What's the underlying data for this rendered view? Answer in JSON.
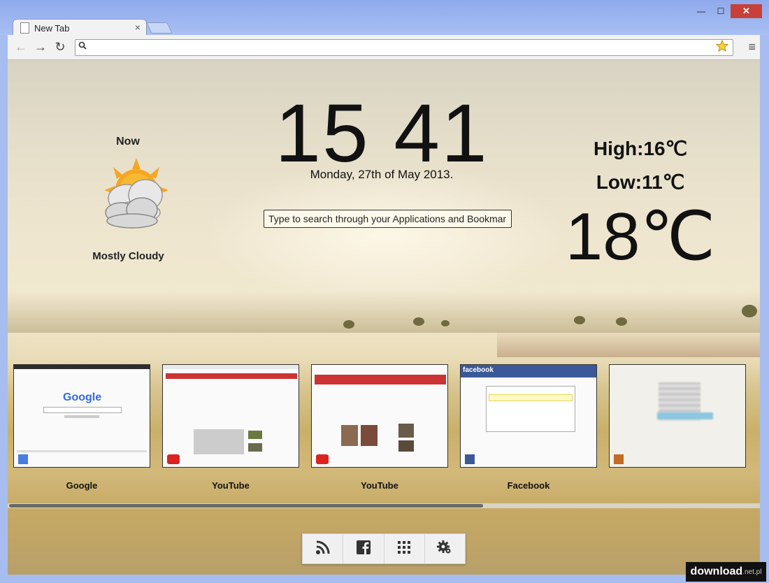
{
  "browser": {
    "tab_title": "New Tab",
    "tab_close": "×",
    "omnibox_value": "",
    "window_buttons": {
      "minimize": "—",
      "maximize": "☐",
      "close": "✕"
    },
    "nav": {
      "back": "←",
      "forward": "→",
      "reload": "↻"
    },
    "menu_icon": "≡",
    "star_icon": "☆"
  },
  "weather": {
    "now_label": "Now",
    "condition": "Mostly Cloudy",
    "high": "High:16℃",
    "low": "Low:11℃",
    "current_temp": "18℃"
  },
  "clock": {
    "time": "15 41",
    "date": "Monday, 27th of May 2013."
  },
  "search": {
    "placeholder": "Type to search through your Applications and Bookmarks"
  },
  "tiles": [
    {
      "label": "Google",
      "logo_text": "Google"
    },
    {
      "label": "YouTube"
    },
    {
      "label": "YouTube"
    },
    {
      "label": "Facebook",
      "logo_text": "facebook"
    },
    {
      "label": ""
    }
  ],
  "scroll_position": 0.63,
  "dock": [
    {
      "name": "rss-icon"
    },
    {
      "name": "facebook-icon"
    },
    {
      "name": "apps-grid-icon"
    },
    {
      "name": "settings-gear-icon"
    }
  ],
  "watermark": {
    "main": "download",
    "suffix": ".net.pl"
  }
}
